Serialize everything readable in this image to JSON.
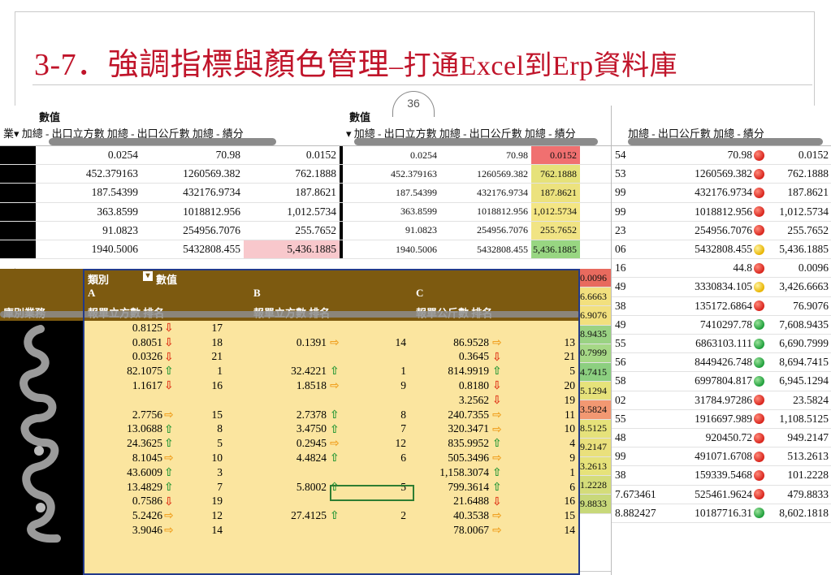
{
  "slide": {
    "title_main": "3-7．強調指標與顏色管理",
    "title_sub": "–打通Excel到Erp資料庫",
    "page_number": "36"
  },
  "shot1": {
    "header_title": "數值",
    "header_cols": "業▾ 加總 - 出口立方數    加總 - 出口公斤數    加總 - 績分",
    "rows": [
      [
        "0.0254",
        "70.98",
        "0.0152"
      ],
      [
        "452.379163",
        "1260569.382",
        "762.1888"
      ],
      [
        "187.54399",
        "432176.9734",
        "187.8621"
      ],
      [
        "363.8599",
        "1018812.956",
        "1,012.5734"
      ],
      [
        "91.0823",
        "254956.7076",
        "255.7652"
      ],
      [
        "1940.5006",
        "5432808.455",
        "5,436.1885"
      ]
    ],
    "highlight_color": "#f8c8cc"
  },
  "shot2": {
    "header_title": "數值",
    "header_cols": "▾ 加總 - 出口立方數   加總 - 出口公斤數   加總 - 績分",
    "rows": [
      [
        "0.0254",
        "70.98",
        "0.0152"
      ],
      [
        "452.379163",
        "1260569.382",
        "762.1888"
      ],
      [
        "187.54399",
        "432176.9734",
        "187.8621"
      ],
      [
        "363.8599",
        "1018812.956",
        "1,012.5734"
      ],
      [
        "91.0823",
        "254956.7076",
        "255.7652"
      ],
      [
        "1940.5006",
        "5432808.455",
        "5,436.1885"
      ]
    ],
    "scale_colors": [
      "#f07070",
      "#e6e27a",
      "#ece27e",
      "#f4e684",
      "#f1e484",
      "#98d682"
    ],
    "side_values": [
      "0.0096",
      "6.6663",
      "6.9076",
      "8.9435",
      "0.7999",
      "4.7415",
      "5.1294",
      "3.5824",
      "8.5125",
      "9.2147",
      "3.2613",
      "1.2228",
      "9.8833"
    ],
    "side_colors": [
      "#e86a5e",
      "#f2e07e",
      "#f2e07e",
      "#9ad283",
      "#a6d886",
      "#8ccf80",
      "#e6e27a",
      "#f29872",
      "#e6e27a",
      "#eae07c",
      "#e6e27a",
      "#d4dc7a",
      "#c8d87a"
    ]
  },
  "shot3": {
    "header_cols": "加總 - 出口公斤數   加總 - 績分",
    "partial_col": [
      "54",
      "53",
      "99",
      "99",
      "23",
      "06",
      "16",
      "49",
      "38",
      "49",
      "55",
      "56",
      "58",
      "02",
      "55",
      "48",
      "99",
      "38",
      "7.673461",
      "8.882427"
    ],
    "rows": [
      [
        "70.98",
        "red",
        "0.0152"
      ],
      [
        "1260569.382",
        "red",
        "762.1888"
      ],
      [
        "432176.9734",
        "red",
        "187.8621"
      ],
      [
        "1018812.956",
        "red",
        "1,012.5734"
      ],
      [
        "254956.7076",
        "red",
        "255.7652"
      ],
      [
        "5432808.455",
        "yellow",
        "5,436.1885"
      ],
      [
        "44.8",
        "red",
        "0.0096"
      ],
      [
        "3330834.105",
        "yellow",
        "3,426.6663"
      ],
      [
        "135172.6864",
        "red",
        "76.9076"
      ],
      [
        "7410297.78",
        "green",
        "7,608.9435"
      ],
      [
        "6863103.111",
        "green",
        "6,690.7999"
      ],
      [
        "8449426.748",
        "green",
        "8,694.7415"
      ],
      [
        "6997804.817",
        "green",
        "6,945.1294"
      ],
      [
        "31784.97286",
        "red",
        "23.5824"
      ],
      [
        "1916697.989",
        "red",
        "1,108.5125"
      ],
      [
        "920450.72",
        "red",
        "949.2147"
      ],
      [
        "491071.6708",
        "red",
        "513.2613"
      ],
      [
        "159339.5468",
        "red",
        "101.2228"
      ],
      [
        "525461.9624",
        "red",
        "479.8833"
      ],
      [
        "10187716.31",
        "green",
        "8,602.1818"
      ]
    ]
  },
  "pivot": {
    "header": {
      "category": "類別",
      "filter_icon": "filter-icon",
      "values": "數值",
      "col_a": "A",
      "col_b": "B",
      "col_c": "C",
      "row_label": "庫別業務",
      "col_a_sub": "報單立方數  排名",
      "col_b_sub": "報單立方數  排名",
      "col_c_sub": "報單公斤數  排名"
    },
    "rows": [
      [
        "0.8125",
        "down",
        "17",
        "",
        "",
        "",
        "",
        "",
        ""
      ],
      [
        "0.8051",
        "down",
        "18",
        "0.1391",
        "side",
        "14",
        "86.9528",
        "side",
        "13"
      ],
      [
        "0.0326",
        "down",
        "21",
        "",
        "",
        "",
        "0.3645",
        "down",
        "21"
      ],
      [
        "82.1075",
        "up",
        "1",
        "32.4221",
        "up",
        "1",
        "814.9919",
        "up",
        "5"
      ],
      [
        "1.1617",
        "down",
        "16",
        "1.8518",
        "side",
        "9",
        "0.8180",
        "down",
        "20"
      ],
      [
        "",
        "",
        "",
        "",
        "",
        "",
        "3.2562",
        "down",
        "19"
      ],
      [
        "2.7756",
        "side",
        "15",
        "2.7378",
        "up",
        "8",
        "240.7355",
        "side",
        "11"
      ],
      [
        "13.0688",
        "up",
        "8",
        "3.4750",
        "up",
        "7",
        "320.3471",
        "side",
        "10"
      ],
      [
        "24.3625",
        "up",
        "5",
        "0.2945",
        "side",
        "12",
        "835.9952",
        "up",
        "4"
      ],
      [
        "8.1045",
        "side",
        "10",
        "4.4824",
        "up",
        "6",
        "505.3496",
        "side",
        "9"
      ],
      [
        "43.6009",
        "up",
        "3",
        "",
        "",
        "",
        "1,158.3074",
        "up",
        "1"
      ],
      [
        "13.4829",
        "up",
        "7",
        "5.8002",
        "up",
        "5",
        "799.3614",
        "up",
        "6"
      ],
      [
        "0.7586",
        "down",
        "19",
        "",
        "",
        "",
        "21.6488",
        "down",
        "16"
      ],
      [
        "5.2426",
        "side",
        "12",
        "27.4125",
        "up",
        "2",
        "40.3538",
        "side",
        "15"
      ],
      [
        "3.9046",
        "side",
        "14",
        "",
        "",
        "",
        "78.0067",
        "side",
        "14"
      ]
    ]
  }
}
